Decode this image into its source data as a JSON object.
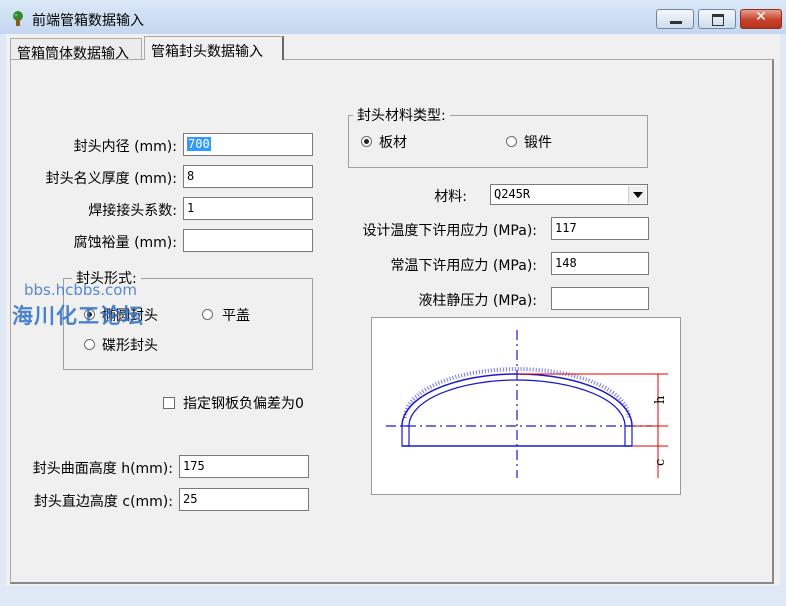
{
  "window": {
    "title": "前端管箱数据输入",
    "icon": "tree-icon",
    "controls": [
      "minimize",
      "maximize",
      "close"
    ]
  },
  "tabs": [
    {
      "label": "管箱筒体数据输入",
      "active": false
    },
    {
      "label": "管箱封头数据输入",
      "active": true
    }
  ],
  "left_fields": [
    {
      "label": "封头内径 (mm):",
      "value": "700",
      "selected": true
    },
    {
      "label": "封头名义厚度 (mm):",
      "value": "8"
    },
    {
      "label": "焊接接头系数:",
      "value": "1"
    },
    {
      "label": "腐蚀裕量 (mm):",
      "value": ""
    }
  ],
  "head_form": {
    "legend": "封头形式:",
    "options": [
      "椭圆封头",
      "平盖",
      "碟形封头"
    ],
    "selected": "椭圆封头"
  },
  "material_type": {
    "legend": "封头材料类型:",
    "options": [
      "板材",
      "锻件"
    ],
    "selected": "板材"
  },
  "material": {
    "label": "材料:",
    "value": "Q245R"
  },
  "right_fields": [
    {
      "label": "设计温度下许用应力 (MPa):",
      "value": "117"
    },
    {
      "label": "常温下许用应力 (MPa):",
      "value": "148"
    },
    {
      "label": "液柱静压力 (MPa):",
      "value": ""
    }
  ],
  "checkbox": {
    "label": "指定钢板负偏差为0",
    "checked": false
  },
  "bottom_fields": [
    {
      "label": "封头曲面高度 h(mm):",
      "value": "175"
    },
    {
      "label": "封头直边高度 c(mm):",
      "value": "25"
    }
  ],
  "diagram": {
    "labels": {
      "h": "h",
      "c": "c"
    }
  },
  "watermark": {
    "url": "bbs.hcbbs.com",
    "text": "海川化工论坛"
  },
  "colors": {
    "diagram_line": "#1a1acc",
    "dimension": "#e00000",
    "selection": "#3399ff"
  }
}
